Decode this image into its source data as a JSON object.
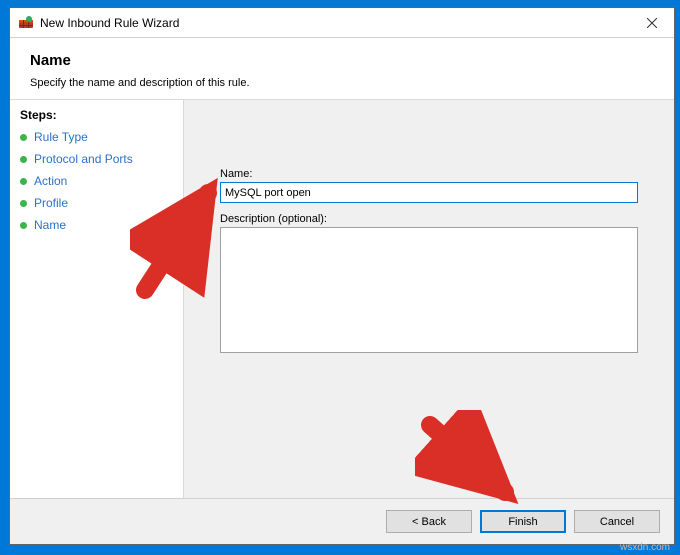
{
  "window": {
    "title": "New Inbound Rule Wizard"
  },
  "header": {
    "title": "Name",
    "subtitle": "Specify the name and description of this rule."
  },
  "steps": {
    "header": "Steps:",
    "items": [
      {
        "label": "Rule Type"
      },
      {
        "label": "Protocol and Ports"
      },
      {
        "label": "Action"
      },
      {
        "label": "Profile"
      },
      {
        "label": "Name"
      }
    ]
  },
  "form": {
    "name_label": "Name:",
    "name_value": "MySQL port open",
    "desc_label": "Description (optional):",
    "desc_value": ""
  },
  "buttons": {
    "back": "< Back",
    "finish": "Finish",
    "cancel": "Cancel"
  },
  "watermark": "wsxdn.com"
}
